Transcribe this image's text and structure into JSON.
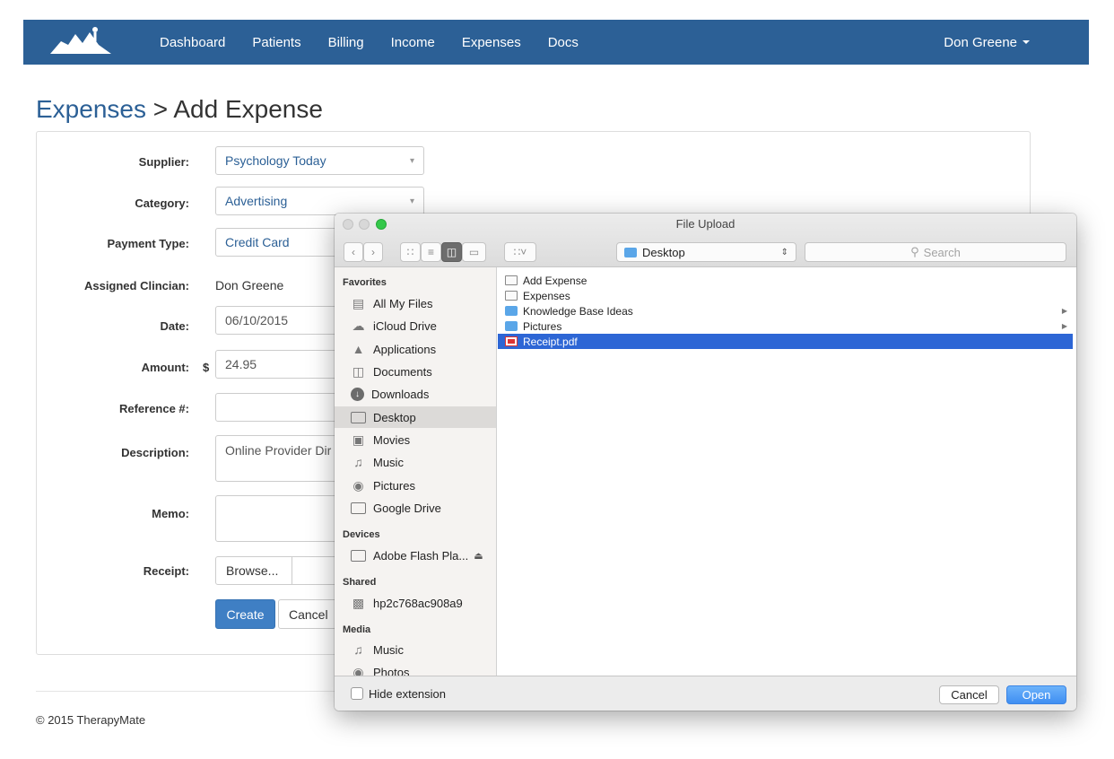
{
  "navbar": {
    "logo_icon": "therapymate-logo-icon",
    "links": [
      "Dashboard",
      "Patients",
      "Billing",
      "Income",
      "Expenses",
      "Docs"
    ],
    "user": "Don Greene"
  },
  "page": {
    "breadcrumb": "Expenses",
    "separator": " > ",
    "title": "Add Expense"
  },
  "form": {
    "supplier_label": "Supplier:",
    "supplier_value": "Psychology Today",
    "category_label": "Category:",
    "category_value": "Advertising",
    "payment_label": "Payment Type:",
    "payment_value": "Credit Card",
    "clinician_label": "Assigned Clincian:",
    "clinician_value": "Don Greene",
    "date_label": "Date:",
    "date_value": "06/10/2015",
    "amount_label": "Amount:",
    "currency": "$",
    "amount_value": "24.95",
    "reference_label": "Reference #:",
    "reference_value": "",
    "description_label": "Description:",
    "description_value": "Online Provider Dir",
    "memo_label": "Memo:",
    "memo_value": "",
    "receipt_label": "Receipt:",
    "browse_label": "Browse...",
    "create_label": "Create",
    "cancel_label": "Cancel"
  },
  "footer": "© 2015 TherapyMate",
  "dialog": {
    "title": "File Upload",
    "location": "Desktop",
    "search_placeholder": "Search",
    "sidebar": {
      "favorites_label": "Favorites",
      "favorites": [
        "All My Files",
        "iCloud Drive",
        "Applications",
        "Documents",
        "Downloads",
        "Desktop",
        "Movies",
        "Music",
        "Pictures",
        "Google Drive"
      ],
      "devices_label": "Devices",
      "devices": [
        "Adobe Flash Pla..."
      ],
      "shared_label": "Shared",
      "shared": [
        "hp2c768ac908a9"
      ],
      "media_label": "Media",
      "media": [
        "Music",
        "Photos"
      ]
    },
    "files": [
      "Add Expense",
      "Expenses",
      "Knowledge Base Ideas",
      "Pictures",
      "Receipt.pdf"
    ],
    "hide_extension_label": "Hide extension",
    "cancel_label": "Cancel",
    "open_label": "Open"
  }
}
